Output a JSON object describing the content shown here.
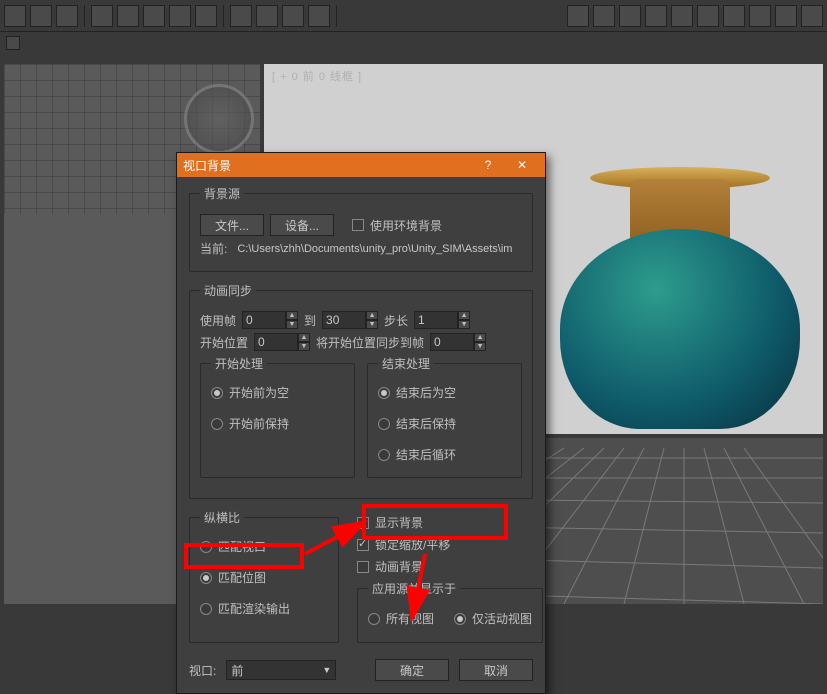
{
  "toolbar": {
    "icons": 18
  },
  "viewports": {
    "vp2_label": "[ +  0 前  0 线框  ]"
  },
  "dialog": {
    "title": "视口背景",
    "help": "?",
    "close": "✕",
    "bg_source": {
      "legend": "背景源",
      "file_btn": "文件...",
      "device_btn": "设备...",
      "use_env_label": "使用环境背景",
      "current_label": "当前:",
      "current_path": "C:\\Users\\zhh\\Documents\\unity_pro\\Unity_SIM\\Assets\\im"
    },
    "anim_sync": {
      "legend": "动画同步",
      "use_frame": "使用帧",
      "use_frame_val": "0",
      "to": "到",
      "to_val": "30",
      "step": "步长",
      "step_val": "1",
      "start_pos": "开始位置",
      "start_pos_val": "0",
      "sync_start": "将开始位置同步到帧",
      "sync_start_val": "0",
      "start_proc": {
        "legend": "开始处理",
        "blank": "开始前为空",
        "hold": "开始前保持"
      },
      "end_proc": {
        "legend": "结束处理",
        "blank": "结束后为空",
        "hold": "结束后保持",
        "loop": "结束后循环"
      }
    },
    "aspect": {
      "legend": "纵横比",
      "match_viewport": "匹配视口",
      "match_bitmap": "匹配位图",
      "match_render": "匹配渲染输出",
      "show_bg": "显示背景",
      "lock_zoom": "锁定缩放/平移",
      "anim_bg": "动画背景",
      "apply_legend": "应用源并显示于",
      "all_views": "所有视图",
      "active_only": "仅活动视图"
    },
    "footer": {
      "viewport_label": "视口:",
      "viewport_value": "前",
      "ok": "确定",
      "cancel": "取消"
    }
  }
}
